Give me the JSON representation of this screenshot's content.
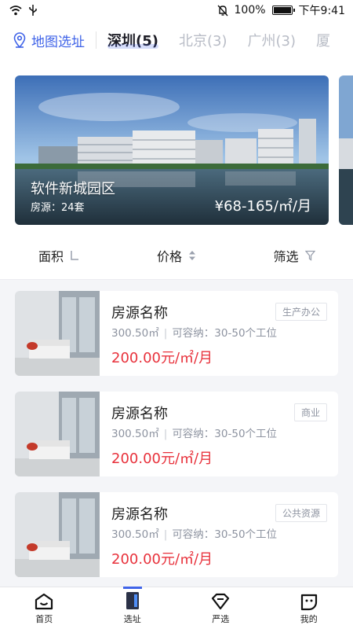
{
  "status": {
    "battery": "100%",
    "time": "下午9:41",
    "battery_level": 1.0
  },
  "header": {
    "map_select": "地图选址",
    "cities": [
      "深圳(5)",
      "北京(3)",
      "广州(3)",
      "厦"
    ]
  },
  "banner": {
    "title": "软件新城园区",
    "count": "房源：24套",
    "price": "¥68-165/㎡/月"
  },
  "filters": [
    "面积",
    "价格",
    "筛选"
  ],
  "listings": [
    {
      "name": "房源名称",
      "tag": "生产办公",
      "area": "300.50㎡",
      "capacity": "可容纳：30-50个工位",
      "price": "200.00元/㎡/月"
    },
    {
      "name": "房源名称",
      "tag": "商业",
      "area": "300.50㎡",
      "capacity": "可容纳：30-50个工位",
      "price": "200.00元/㎡/月"
    },
    {
      "name": "房源名称",
      "tag": "公共资源",
      "area": "300.50㎡",
      "capacity": "可容纳：30-50个工位",
      "price": "200.00元/㎡/月"
    }
  ],
  "tabbar": [
    "首页",
    "选址",
    "严选",
    "我的"
  ],
  "colors": {
    "accent": "#3f63e8",
    "price": "#e8323c"
  }
}
